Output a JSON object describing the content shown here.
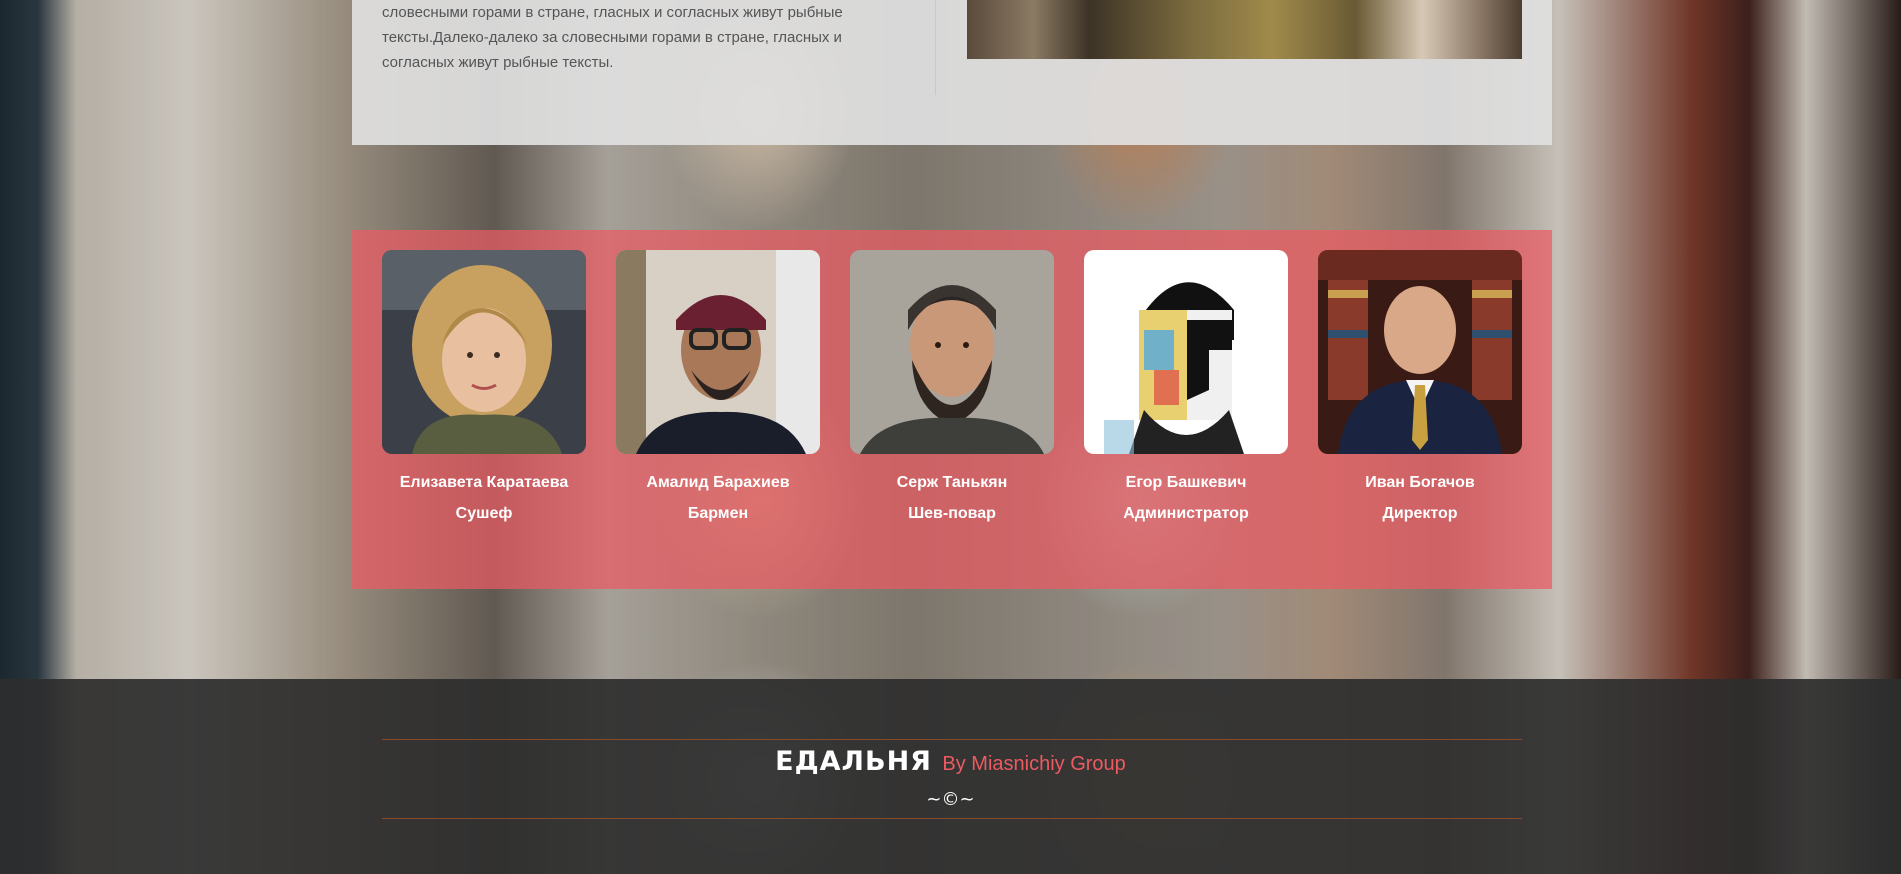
{
  "about": {
    "text": "словесными горами в стране, гласных и согласных живут рыбные тексты.Далеко-далеко за словесными горами в стране, гласных и согласных живут рыбные тексты."
  },
  "team": [
    {
      "name": "Елизавета Каратаева",
      "role": "Сушеф",
      "photo": "woman-curly-hair-portrait"
    },
    {
      "name": "Амалид Барахиев",
      "role": "Бармен",
      "photo": "man-cap-glasses-portrait"
    },
    {
      "name": "Серж Танькян",
      "role": "Шев-повар",
      "photo": "man-beanie-beard-portrait"
    },
    {
      "name": "Егор Башкевич",
      "role": "Администратор",
      "photo": "pop-art-face-portrait"
    },
    {
      "name": "Иван Богачов",
      "role": "Директор",
      "photo": "man-suit-library-portrait"
    }
  ],
  "footer": {
    "brand": "ЕДАЛЬНЯ",
    "group": "By Miasnichiy Group",
    "copyright": "~©~"
  },
  "colors": {
    "accent": "#ec5a62",
    "footer_bg": "#2e2e2e",
    "panel_bg": "#e0e0e0"
  }
}
